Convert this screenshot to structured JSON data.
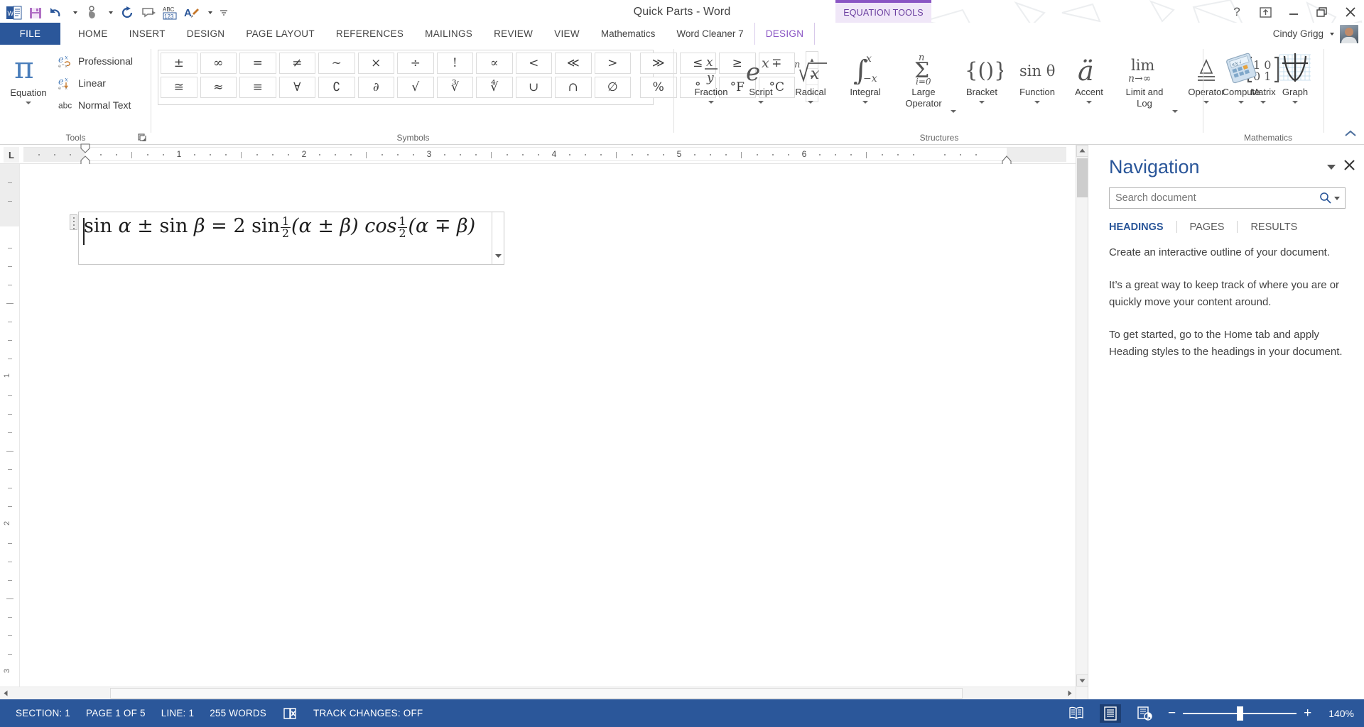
{
  "window": {
    "title": "Quick Parts - Word",
    "help_icon": "help-icon",
    "ribbon_display_icon": "ribbon-display-options-icon",
    "minimize_icon": "minimize-icon",
    "restore_icon": "restore-icon",
    "close_icon": "close-icon"
  },
  "quick_access": [
    {
      "name": "word-logo-icon",
      "label": "W"
    },
    {
      "name": "save-icon",
      "label": "Save"
    },
    {
      "name": "undo-icon",
      "label": "Undo"
    },
    {
      "name": "touch-mode-icon",
      "label": "Touch/Mouse Mode"
    },
    {
      "name": "repeat-icon",
      "label": "Repeat"
    },
    {
      "name": "new-comment-icon",
      "label": "New Comment"
    },
    {
      "name": "word-count-icon",
      "label": "ABC 123"
    },
    {
      "name": "format-painter-icon",
      "label": "Styles"
    },
    {
      "name": "customize-qat-icon",
      "label": "Customize Quick Access Toolbar"
    }
  ],
  "contextual_banner": {
    "label": "EQUATION TOOLS",
    "color": "#8a55c4",
    "bg": "#f0e7f8"
  },
  "tabs": {
    "file": "FILE",
    "items": [
      {
        "label": "HOME",
        "active": false
      },
      {
        "label": "INSERT",
        "active": false
      },
      {
        "label": "DESIGN",
        "active": false
      },
      {
        "label": "PAGE LAYOUT",
        "active": false
      },
      {
        "label": "REFERENCES",
        "active": false
      },
      {
        "label": "MAILINGS",
        "active": false
      },
      {
        "label": "REVIEW",
        "active": false
      },
      {
        "label": "VIEW",
        "active": false
      },
      {
        "label": "Mathematics",
        "active": false
      },
      {
        "label": "Word Cleaner 7",
        "active": false
      }
    ],
    "contextual": {
      "label": "DESIGN",
      "active": true
    }
  },
  "account": {
    "user": "Cindy Grigg",
    "dropdown_icon": "chevron-down-icon",
    "avatar": "user-avatar"
  },
  "ribbon": {
    "groups": [
      {
        "name": "tools",
        "label": "Tools"
      },
      {
        "name": "symbols",
        "label": "Symbols"
      },
      {
        "name": "structures",
        "label": "Structures"
      },
      {
        "name": "mathematics",
        "label": "Mathematics"
      }
    ],
    "tools": {
      "equation_button": {
        "label": "Equation",
        "icon": "pi-icon"
      },
      "items": [
        {
          "label": "Professional",
          "icon": "professional-equation-icon"
        },
        {
          "label": "Linear",
          "icon": "linear-equation-icon"
        },
        {
          "label": "Normal Text",
          "icon": "abc-icon"
        }
      ],
      "dialog_launcher": "dialog-box-launcher-icon"
    },
    "symbols": {
      "row1": [
        "±",
        "∞",
        "=",
        "≠",
        "~",
        "×",
        "÷",
        "!",
        "∝",
        "<",
        "≪",
        ">"
      ],
      "row2": [
        "≅",
        "≈",
        "≡",
        "∀",
        "∁",
        "∂",
        "√",
        "∛",
        "∜",
        "∪",
        "∩",
        "∅"
      ],
      "row1b": [
        "≫",
        "≤",
        "≥",
        "∓"
      ],
      "row2b": [
        "%",
        "°",
        "°F",
        "°C"
      ],
      "scroll_up": "scroll-up-icon",
      "scroll_down": "scroll-down-icon",
      "more": "more-symbols-icon"
    },
    "structures": [
      {
        "label": "Fraction",
        "icon": "fraction-icon"
      },
      {
        "label": "Script",
        "icon": "script-icon"
      },
      {
        "label": "Radical",
        "icon": "radical-icon"
      },
      {
        "label": "Integral",
        "icon": "integral-icon"
      },
      {
        "label": "Large\nOperator",
        "icon": "large-operator-icon"
      },
      {
        "label": "Bracket",
        "icon": "bracket-icon"
      },
      {
        "label": "Function",
        "icon": "function-icon"
      },
      {
        "label": "Accent",
        "icon": "accent-icon"
      },
      {
        "label": "Limit and\nLog",
        "icon": "limit-log-icon"
      },
      {
        "label": "Operator",
        "icon": "operator-icon"
      },
      {
        "label": "Matrix",
        "icon": "matrix-icon"
      }
    ],
    "mathematics": [
      {
        "label": "Compute",
        "icon": "calculator-icon"
      },
      {
        "label": "Graph",
        "icon": "graph-icon"
      }
    ],
    "collapse_icon": "collapse-ribbon-icon"
  },
  "ruler": {
    "tab_selector": "L",
    "horizontal_numbers": [
      "1",
      "2",
      "3",
      "4",
      "5",
      "6"
    ],
    "vertical_numbers": [
      "1",
      "2",
      "3"
    ]
  },
  "document": {
    "equation": {
      "parts": [
        "sin α ± sin β = 2 sin ",
        "1/2",
        "(α ± β) cos ",
        "1/2",
        "(α ∓ β)"
      ],
      "text": "sin α ± sin β = 2 sin ½(α ± β) cos ½(α ∓ β)",
      "lead": "sin ",
      "alpha": "α",
      "plusminus": "±",
      "sin2": " sin ",
      "beta": "β",
      "equals": " = 2 sin",
      "numerator": "1",
      "denominator": "2",
      "group1": "(α ± β) cos",
      "group2": "(α ∓ β)",
      "handle_icon": "equation-move-handle",
      "scroll_icon": "equation-scroll-down-icon"
    }
  },
  "navigation": {
    "title": "Navigation",
    "dropdown_icon": "chevron-down-icon",
    "close_icon": "close-icon",
    "search": {
      "placeholder": "Search document",
      "value": "",
      "icon": "search-icon",
      "dropdown_icon": "search-options-icon"
    },
    "tabs": [
      {
        "label": "HEADINGS",
        "active": true
      },
      {
        "label": "PAGES",
        "active": false
      },
      {
        "label": "RESULTS",
        "active": false
      }
    ],
    "paragraphs": [
      "Create an interactive outline of your document.",
      "It’s a great way to keep track of where you are or quickly move your content around.",
      "To get started, go to the Home tab and apply Heading styles to the headings in your document."
    ]
  },
  "status_bar": {
    "section": "SECTION: 1",
    "page": "PAGE 1 OF 5",
    "line": "LINE: 1",
    "words": "255 WORDS",
    "proofing_icon": "proofing-errors-icon",
    "track_changes": "TRACK CHANGES: OFF",
    "view_buttons": [
      {
        "name": "read-mode-icon",
        "active": false
      },
      {
        "name": "print-layout-icon",
        "active": true
      },
      {
        "name": "web-layout-icon",
        "active": false
      }
    ],
    "zoom": {
      "out_icon": "zoom-out-icon",
      "in_icon": "zoom-in-icon",
      "level": "140%"
    }
  },
  "colors": {
    "word_blue": "#2b579a",
    "equation_purple": "#8a55c4",
    "nav_heading_blue": "#2a5699"
  }
}
